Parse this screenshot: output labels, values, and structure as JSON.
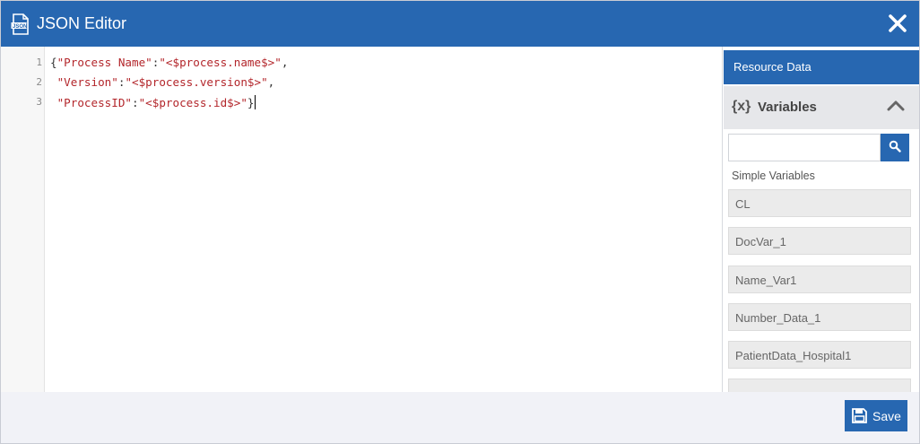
{
  "window": {
    "title": "JSON Editor",
    "title_icon": "json-file-icon",
    "close_icon": "close-icon"
  },
  "editor": {
    "lines": [
      {
        "number": "1",
        "text": "{\"Process Name\":\"<$process.name$>\","
      },
      {
        "number": "2",
        "text": " \"Version\":\"<$process.version$>\","
      },
      {
        "number": "3",
        "text": " \"ProcessID\":\"<$process.id$>\"}"
      }
    ]
  },
  "sidebar": {
    "header": "Resource Data",
    "section": {
      "icon_text": "{x}",
      "label": "Variables",
      "toggle_icon": "chevron-up-icon"
    },
    "search": {
      "value": "",
      "placeholder": "",
      "icon": "search-icon"
    },
    "group_label": "Simple Variables",
    "items": [
      {
        "label": "CL"
      },
      {
        "label": "DocVar_1"
      },
      {
        "label": "Name_Var1"
      },
      {
        "label": "Number_Data_1"
      },
      {
        "label": "PatientData_Hospital1"
      }
    ]
  },
  "footer": {
    "save_label": "Save",
    "save_icon": "floppy-disk-icon"
  },
  "colors": {
    "accent": "#2767b1",
    "string": "#b3262b"
  }
}
